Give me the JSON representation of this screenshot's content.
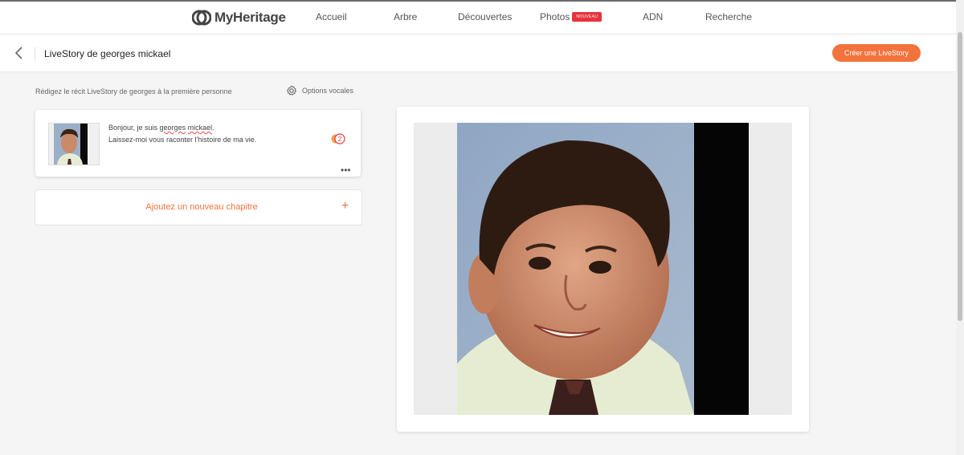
{
  "nav": {
    "logo": "MyHeritage",
    "items": [
      {
        "label": "Accueil"
      },
      {
        "label": "Arbre"
      },
      {
        "label": "Découvertes"
      },
      {
        "label": "Photos",
        "badge": "NOUVEAU"
      },
      {
        "label": "ADN"
      },
      {
        "label": "Recherche"
      }
    ]
  },
  "header": {
    "title": "LiveStory de georges mickael",
    "create_button": "Créer une LiveStory"
  },
  "editor": {
    "instruction": "Rédigez le récit LiveStory de georges à la première personne",
    "voice_options": "Options vocales",
    "chapters": [
      {
        "line1_prefix": "Bonjour, je suis ",
        "name_first": "georges",
        "name_last": "mickael",
        "line1_suffix": ".",
        "line2": "Laissez-moi vous raconter l'histoire de ma vie.",
        "audio_count": "2",
        "more": "•••"
      }
    ],
    "add_chapter": "Ajoutez un nouveau chapitre",
    "add_icon": "+"
  },
  "icons": {
    "back": "chevron-left-icon",
    "gear": "gear-icon",
    "audio": "audio-count-icon",
    "more": "more-dots-icon"
  },
  "colors": {
    "accent": "#f3733c",
    "badge": "#e8323c"
  }
}
